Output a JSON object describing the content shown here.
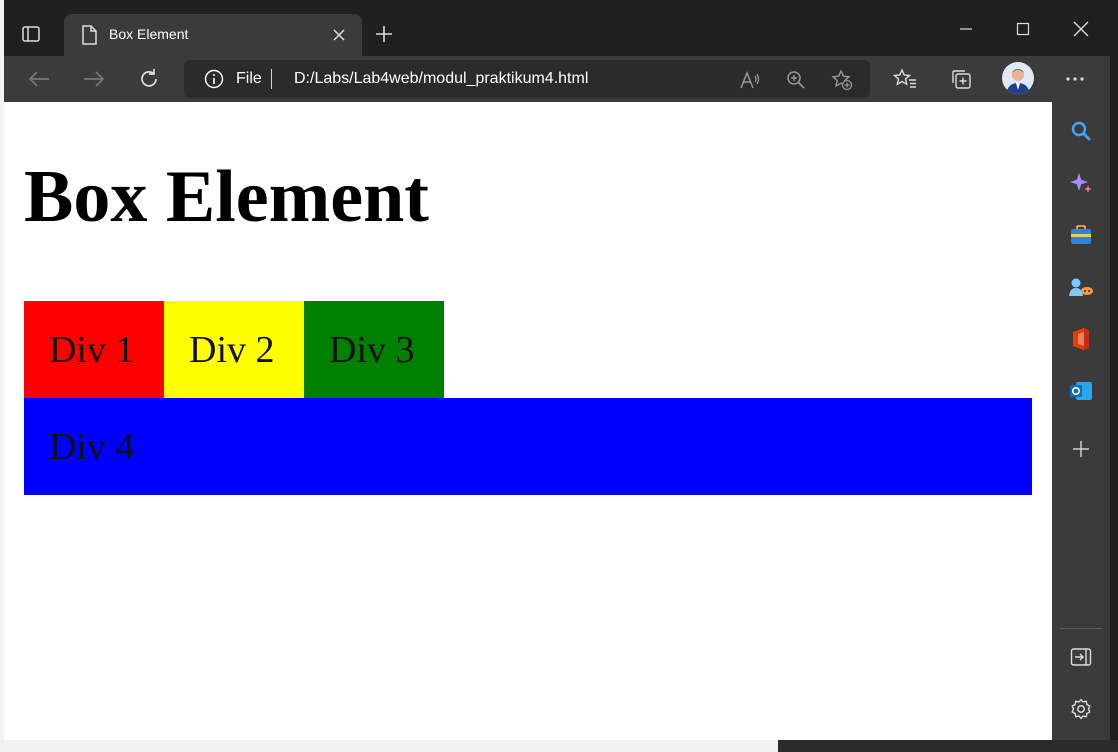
{
  "browser": {
    "tab_title": "Box Element",
    "address": {
      "scheme_label": "File",
      "url": "D:/Labs/Lab4web/modul_praktikum4.html"
    }
  },
  "page": {
    "heading": "Box Element",
    "boxes": [
      {
        "label": "Div 1",
        "color": "#ff0000"
      },
      {
        "label": "Div 2",
        "color": "#ffff00"
      },
      {
        "label": "Div 3",
        "color": "#008000"
      },
      {
        "label": "Div 4",
        "color": "#0000ff"
      }
    ]
  },
  "sidebar": {
    "items": [
      "search-icon",
      "copilot-icon",
      "tools-icon",
      "games-icon",
      "office-icon",
      "outlook-icon",
      "add-icon"
    ],
    "bottom": [
      "hide-sidebar-icon",
      "settings-icon"
    ]
  },
  "colors": {
    "titlebar": "#202020",
    "toolbar": "#3b3b3b",
    "address_bar": "#2b2b2b"
  }
}
